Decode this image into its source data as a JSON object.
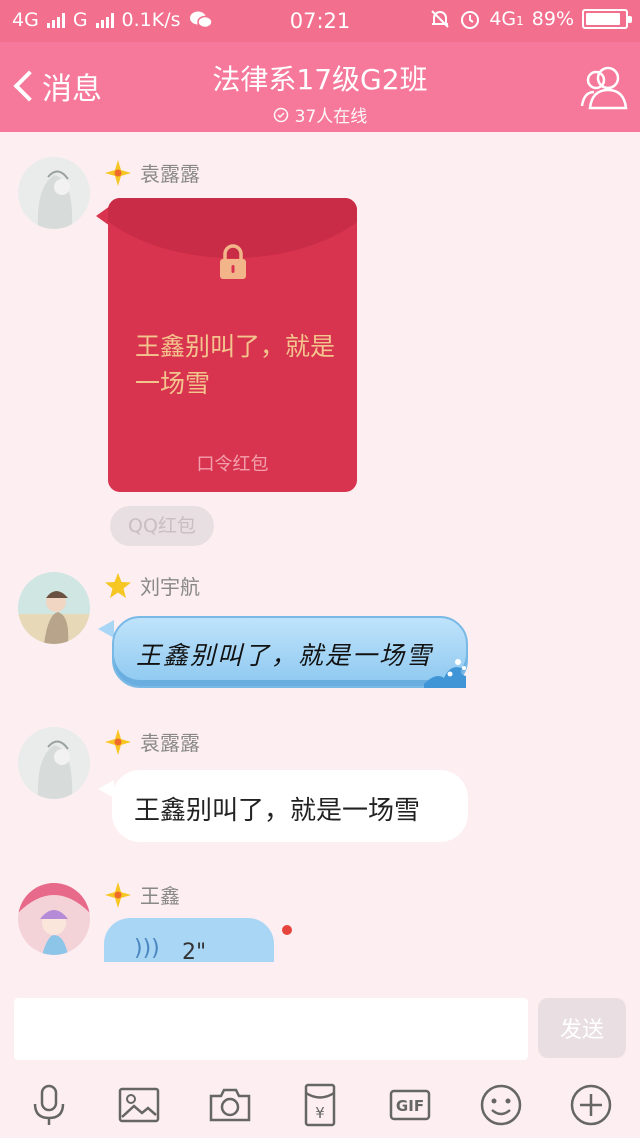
{
  "status_bar": {
    "network1": "4G",
    "network2": "G",
    "speed": "0.1K/s",
    "time": "07:21",
    "network3": "4G",
    "network3_sub": "1",
    "battery": "89%",
    "battery_level": 0.89
  },
  "header": {
    "back_label": "消息",
    "title": "法律系17级G2班",
    "online": "37人在线"
  },
  "messages": [
    {
      "sender": "袁露露",
      "type": "red_packet",
      "packet_text": "王鑫别叫了，就是一场雪",
      "packet_type": "口令红包",
      "tag": "QQ红包"
    },
    {
      "sender": "刘宇航",
      "type": "text_styled",
      "text": "王鑫别叫了，就是一场雪"
    },
    {
      "sender": "袁露露",
      "type": "text",
      "text": "王鑫别叫了，就是一场雪"
    },
    {
      "sender": "王鑫",
      "type": "voice",
      "duration": "2\""
    }
  ],
  "input": {
    "value": "",
    "send_label": "发送"
  },
  "toolbar": {
    "items": [
      "mic-icon",
      "image-icon",
      "camera-icon",
      "red-packet-icon",
      "gif-icon",
      "emoji-icon",
      "plus-icon"
    ],
    "gif_label": "GIF",
    "yen_label": "¥"
  },
  "colors": {
    "header": "#f6789a",
    "statusbar": "#f26f8e",
    "background": "#fdeef1",
    "red_packet": "#d9344f",
    "packet_text": "#f3c48e",
    "blue_bubble": "#a9d6f5"
  }
}
